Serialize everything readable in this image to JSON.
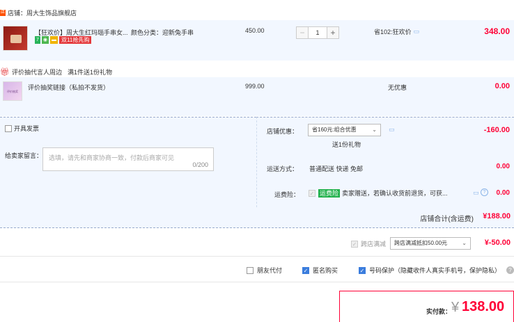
{
  "shop": {
    "label": "店铺：",
    "name": "周大生饰品旗舰店"
  },
  "item1": {
    "title": "【狂欢价】周大生红玛瑙手串女...",
    "sku_label": "颜色分类：",
    "sku_value": "迎新兔手串",
    "price": "450.00",
    "qty": "1",
    "promo": "省102:狂欢价",
    "subtotal": "348.00",
    "badge": "双11抢先购",
    "badge_num": "7"
  },
  "gift": {
    "header_label": "评价抽代言人周边",
    "header_note": "满1件送1份礼物",
    "title": "评价抽奖链接（私拍不发货）",
    "price": "999.00",
    "promo": "无优惠",
    "subtotal": "0.00"
  },
  "invoice": {
    "label": "开具发票"
  },
  "message": {
    "label": "给卖家留言：",
    "placeholder": "选填，请先和商家协商一致，付款后商家可见",
    "counter": "0/200"
  },
  "shop_discount": {
    "label": "店铺优惠：",
    "selected": "省160元:组合优惠",
    "note": "送1份礼物",
    "amount": "-160.00"
  },
  "shipping": {
    "label": "运送方式：",
    "value": "普通配送 快递 免邮",
    "amount": "0.00"
  },
  "insurance": {
    "label": "运费险：",
    "badge": "运费险",
    "text": "卖家赠送，若确认收货前退货，可获...",
    "amount": "0.00"
  },
  "shop_total": {
    "label": "店铺合计(含运费)",
    "amount": "¥188.00"
  },
  "cross_store": {
    "label": "跨店满减",
    "selected": "跨店满减抵扣50.00元",
    "amount": "¥-50.00"
  },
  "options": {
    "friend_pay": "朋友代付",
    "anonymous": "匿名购买",
    "privacy": "号码保护",
    "privacy_note": "（隐藏收件人真实手机号，保护隐私）"
  },
  "payment": {
    "label": "实付款：",
    "currency": "¥",
    "amount": "138.00"
  },
  "colors": {
    "accent": "#ff0036",
    "row_bg": "#f2f7ff",
    "checkbox": "#3b7ddd"
  }
}
